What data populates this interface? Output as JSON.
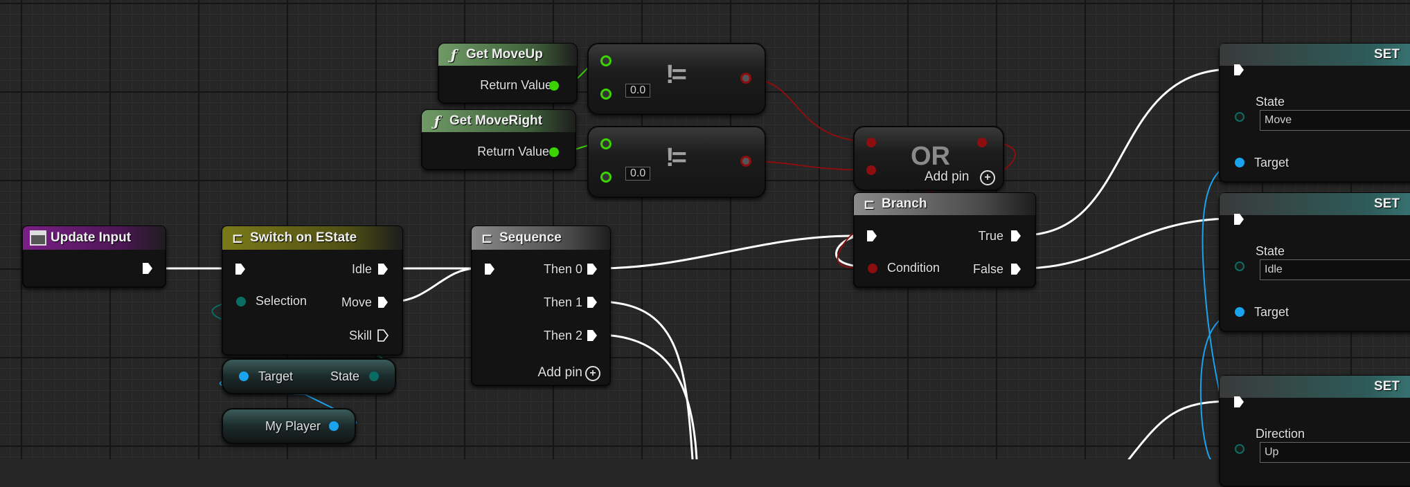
{
  "nodes": {
    "update_input": {
      "title": "Update Input"
    },
    "switch": {
      "title": "Switch on EState",
      "selection": "Selection",
      "outputs": [
        "Idle",
        "Move",
        "Skill"
      ]
    },
    "get_target": {
      "target": "Target",
      "state": "State"
    },
    "my_player": {
      "label": "My Player"
    },
    "sequence": {
      "title": "Sequence",
      "outputs": [
        "Then 0",
        "Then 1",
        "Then 2"
      ],
      "add_pin": "Add pin"
    },
    "get_moveup": {
      "title": "Get MoveUp",
      "return_value": "Return Value"
    },
    "get_moveright": {
      "title": "Get MoveRight",
      "return_value": "Return Value"
    },
    "neq1": {
      "value": "0.0",
      "symbol": "!="
    },
    "neq2": {
      "value": "0.0",
      "symbol": "!="
    },
    "or": {
      "title": "OR",
      "add_pin": "Add pin"
    },
    "branch": {
      "title": "Branch",
      "condition": "Condition",
      "true_label": "True",
      "false_label": "False"
    },
    "set1": {
      "title": "SET",
      "field_label": "State",
      "field_value": "Move",
      "target": "Target"
    },
    "set2": {
      "title": "SET",
      "field_label": "State",
      "field_value": "Idle",
      "target": "Target"
    },
    "set3": {
      "title": "SET",
      "field_label": "Direction",
      "field_value": "Up"
    }
  },
  "icons": {
    "function": "function-icon",
    "event": "event-icon",
    "switch": "switch-icon",
    "sequence": "sequence-icon",
    "branch": "branch-icon",
    "add": "add-pin-icon"
  },
  "colors": {
    "exec": "#ffffff",
    "bool": "#8c0e0e",
    "float": "#3cd400",
    "enum": "#0a6d64",
    "object": "#1aa3ee",
    "event_header": "#7a1f86",
    "func_header": "#4f7a4a",
    "switch_header": "#7a7a1a",
    "set_header": "#2d5a58"
  }
}
